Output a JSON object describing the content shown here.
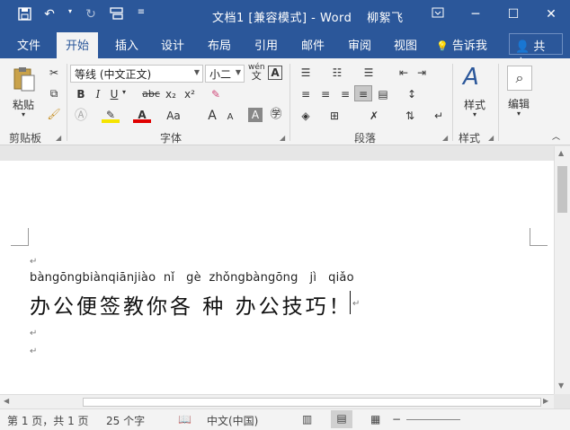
{
  "titlebar": {
    "title": "文档1 [兼容模式] - Word",
    "user": "柳絮飞",
    "qat": [
      "save-icon",
      "undo-icon",
      "redo-icon",
      "touch-mode-icon",
      "customize-icon"
    ],
    "window_buttons": [
      "─",
      "☐",
      "✕"
    ]
  },
  "tabs": {
    "file": "文件",
    "home": "开始",
    "insert": "插入",
    "design": "设计",
    "layout": "布局",
    "references": "引用",
    "mailings": "邮件",
    "review": "审阅",
    "view": "视图",
    "tell_me": "告诉我",
    "share": "共享"
  },
  "ribbon": {
    "clipboard": {
      "label": "剪贴板",
      "paste": "粘贴"
    },
    "font": {
      "label": "字体",
      "font_name": "等线 (中文正文)",
      "font_size": "小二",
      "bold": "B",
      "italic": "I",
      "underline": "U",
      "strike": "abc",
      "subscript": "x₂",
      "superscript": "x²",
      "grow": "A",
      "shrink": "A",
      "case": "Aa",
      "wen": "wén"
    },
    "paragraph": {
      "label": "段落"
    },
    "styles": {
      "label": "样式",
      "button": "样式"
    },
    "editing": {
      "button": "编辑"
    }
  },
  "document": {
    "pinyin_line": "bàngōngbiànqiānjiào  nǐ   gè  zhǒngbàngōng   jì   qiǎo",
    "text_line": "办公便签教你各 种 办公技巧！",
    "para_mark": "↵"
  },
  "statusbar": {
    "page": "第 1 页，共 1 页",
    "words": "25 个字",
    "language": "中文(中国)"
  },
  "colors": {
    "accent": "#2b579a"
  }
}
